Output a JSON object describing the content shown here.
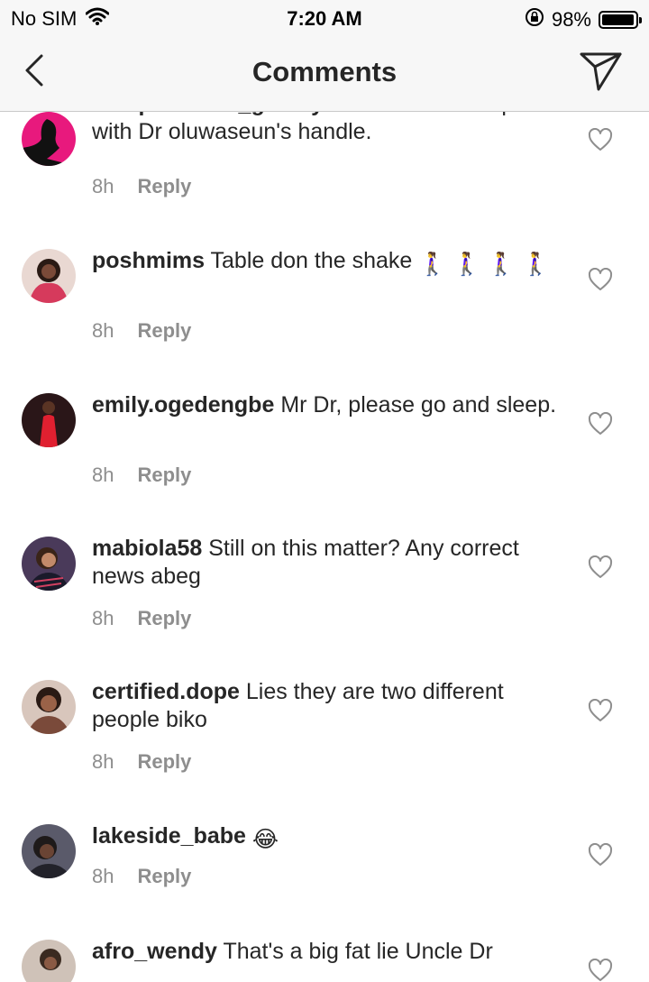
{
  "status_bar": {
    "carrier": "No SIM",
    "time": "7:20 AM",
    "battery": "98%",
    "battery_level": 0.98
  },
  "nav": {
    "title": "Comments"
  },
  "reply_label": "Reply",
  "comments": [
    {
      "username": "chaqueenhair_gallery",
      "text": "can.someone help me with Dr oluwaseun's handle.",
      "time": "8h",
      "avatar_color": "#e8197d"
    },
    {
      "username": "poshmims",
      "text": "Table don the shake",
      "emoji": "🚶‍♀️ 🚶‍♀️ 🚶‍♀️ 🚶‍♀️",
      "time": "8h",
      "avatar_color": "#c23a55"
    },
    {
      "username": "emily.ogedengbe",
      "text": "Mr Dr, please go and sleep.",
      "time": "8h",
      "avatar_color": "#6b1a1f"
    },
    {
      "username": "mabiola58",
      "text": "Still on this matter? Any correct news abeg",
      "time": "8h",
      "avatar_color": "#3a2f4a"
    },
    {
      "username": "certified.dope",
      "text": "Lies they are two different people biko",
      "time": "8h",
      "avatar_color": "#8a5a4a"
    },
    {
      "username": "lakeside_babe",
      "text": "",
      "emoji": "😂",
      "time": "8h",
      "avatar_color": "#3b3b4a"
    },
    {
      "username": "afro_wendy",
      "text": "That's a big fat lie Uncle Dr",
      "time": "",
      "avatar_color": "#7a6a60"
    }
  ]
}
